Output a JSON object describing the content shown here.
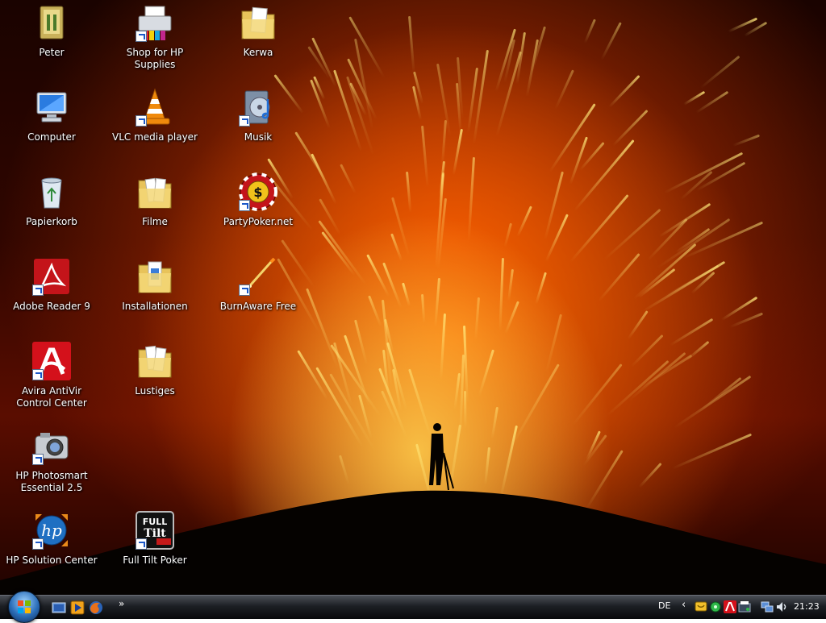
{
  "desktop": {
    "icons": [
      {
        "label": "Peter",
        "icon": "user-folder-icon"
      },
      {
        "label": "Shop for HP Supplies",
        "icon": "printer-shop-icon"
      },
      {
        "label": "Kerwa",
        "icon": "folder-icon"
      },
      {
        "label": "Computer",
        "icon": "computer-icon"
      },
      {
        "label": "VLC media player",
        "icon": "vlc-cone-icon"
      },
      {
        "label": "Musik",
        "icon": "music-folder-icon"
      },
      {
        "label": "Papierkorb",
        "icon": "recycle-bin-icon"
      },
      {
        "label": "Filme",
        "icon": "folder-icon"
      },
      {
        "label": "PartyPoker.net",
        "icon": "poker-chip-icon"
      },
      {
        "label": "Adobe Reader 9",
        "icon": "adobe-reader-icon"
      },
      {
        "label": "Installationen",
        "icon": "folder-icon"
      },
      {
        "label": "BurnAware Free",
        "icon": "burnaware-icon"
      },
      {
        "label": "Avira AntiVir Control Center",
        "icon": "avira-icon"
      },
      {
        "label": "Lustiges",
        "icon": "folder-icon"
      },
      {
        "label": "HP Photosmart Essential 2.5",
        "icon": "camera-icon"
      },
      {
        "label": "HP Solution Center",
        "icon": "hp-logo-icon"
      },
      {
        "label": "Full Tilt Poker",
        "icon": "full-tilt-poker-icon"
      }
    ]
  },
  "taskbar": {
    "quicklaunch_more": "»",
    "language": "DE",
    "tray_expand": "‹",
    "clock": "21:23"
  },
  "colors": {
    "taskbar": "#1c1f24",
    "folder": "#e8c35a",
    "lava": "#ff7a00"
  }
}
